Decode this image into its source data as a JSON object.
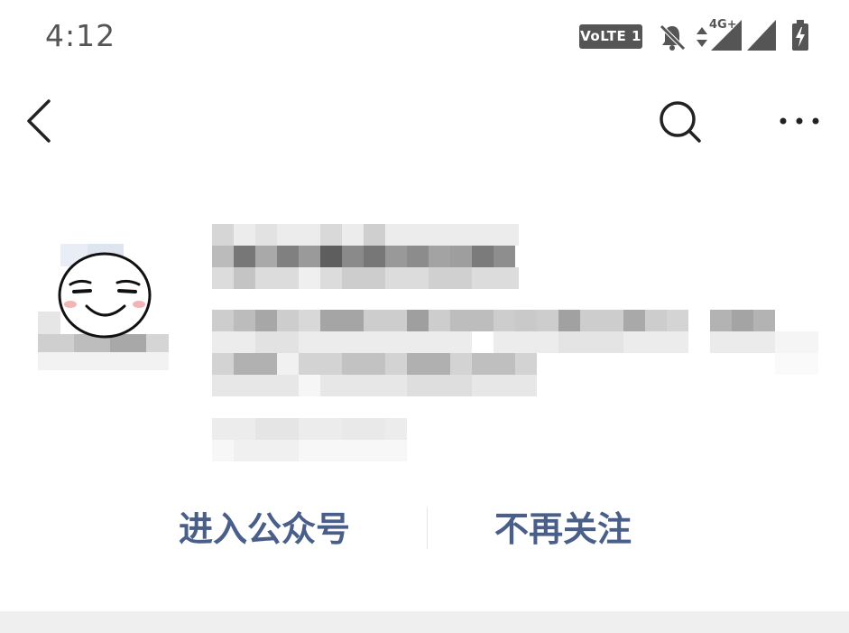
{
  "status_bar": {
    "time": "4:12",
    "volte_label": "VoLTE 1",
    "network_label": "4G+",
    "icons": [
      "volte-icon",
      "mute-bell-icon",
      "data-transfer-icon",
      "signal-icon",
      "signal-2-icon",
      "battery-charging-icon"
    ]
  },
  "nav": {
    "back_icon": "chevron-left-icon",
    "search_icon": "search-icon",
    "more_icon": "more-dots-icon"
  },
  "account": {
    "avatar_icon": "smirk-face-avatar",
    "name": "",
    "description": "",
    "meta": ""
  },
  "actions": {
    "enter_label": "进入公众号",
    "unfollow_label": "不再关注",
    "label_color": "#4a5e8a"
  },
  "colors": {
    "text_gray": "#555555",
    "link_blue": "#4a5e8a",
    "band_gray": "#efefef"
  }
}
